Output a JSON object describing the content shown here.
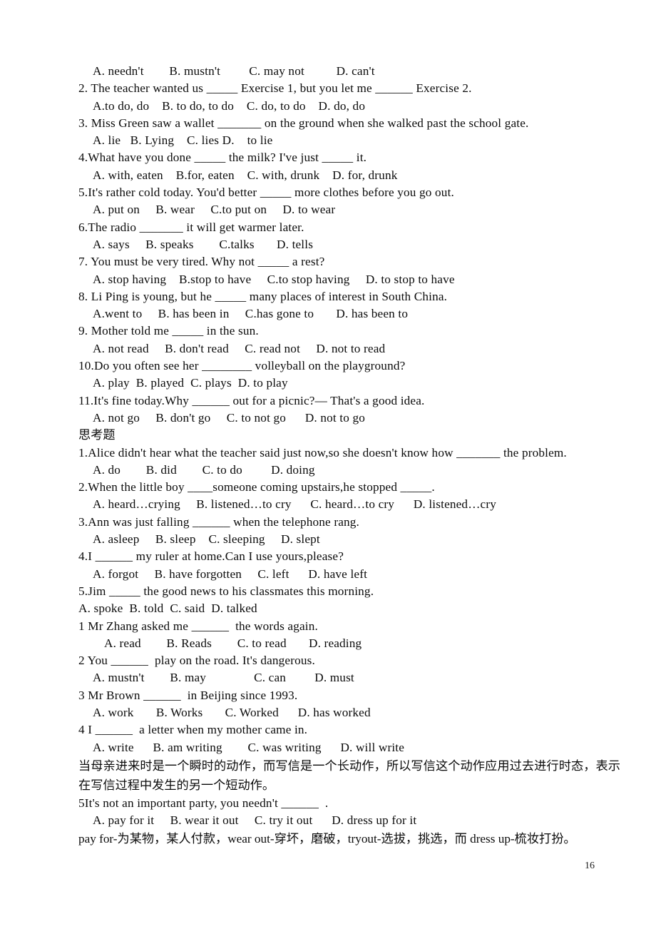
{
  "document": {
    "page_number": "16",
    "sections": [
      {
        "id": "section-main",
        "lines": [
          {
            "type": "option",
            "indent": "normal",
            "text": "A. needn't        B. mustn't         C. may not          D. can't"
          },
          {
            "type": "question",
            "indent": "none",
            "text": "2. The teacher wanted us _____ Exercise 1, but you let me ______ Exercise 2."
          },
          {
            "type": "option",
            "indent": "normal",
            "text": "A.to do, do    B. to do, to do    C. do, to do    D. do, do"
          },
          {
            "type": "question",
            "indent": "none",
            "text": "3. Miss Green saw a wallet _______ on the ground when she walked past the school gate."
          },
          {
            "type": "option",
            "indent": "normal",
            "text": "A. lie   B. Lying    C. lies D.    to lie"
          },
          {
            "type": "question",
            "indent": "none",
            "text": "4.What have you done _____ the milk? I've just _____ it."
          },
          {
            "type": "option",
            "indent": "normal",
            "text": "A. with, eaten    B.for, eaten    C. with, drunk    D. for, drunk"
          },
          {
            "type": "question",
            "indent": "none",
            "text": "5.It's rather cold today. You'd better _____ more clothes before you go out."
          },
          {
            "type": "option",
            "indent": "normal",
            "text": "A. put on     B. wear     C.to put on     D. to wear"
          },
          {
            "type": "question",
            "indent": "none",
            "text": "6.The radio _______ it will get warmer later."
          },
          {
            "type": "option",
            "indent": "normal",
            "text": "A. says     B. speaks        C.talks       D. tells"
          },
          {
            "type": "question",
            "indent": "none",
            "text": "7. You must be very tired. Why not _____ a rest?"
          },
          {
            "type": "option",
            "indent": "normal",
            "text": "A. stop having    B.stop to have     C.to stop having     D. to stop to have"
          },
          {
            "type": "question",
            "indent": "none",
            "text": "8. Li Ping is young, but he _____ many places of interest in South China."
          },
          {
            "type": "option",
            "indent": "normal",
            "text": "A.went to     B. has been in     C.has gone to       D. has been to"
          },
          {
            "type": "question",
            "indent": "none",
            "text": "9. Mother told me _____ in the sun."
          },
          {
            "type": "option",
            "indent": "normal",
            "text": "A. not read     B. don't read     C. read not     D. not to read"
          },
          {
            "type": "question",
            "indent": "none",
            "text": "10.Do you often see her ________ volleyball on the playground?"
          },
          {
            "type": "option",
            "indent": "normal",
            "text": "A. play  B. played  C. plays  D. to play"
          },
          {
            "type": "question",
            "indent": "none",
            "text": "11.It's fine today.Why ______ out for a picnic?— That's a good idea."
          },
          {
            "type": "option",
            "indent": "normal",
            "text": "A. not go     B. don't go     C. to not go      D. not to go"
          }
        ]
      },
      {
        "id": "section-thinking",
        "heading": "思考题",
        "lines": [
          {
            "type": "question",
            "indent": "none",
            "text": "1.Alice didn't hear what the teacher said just now,so she doesn't know how _______ the problem."
          },
          {
            "type": "option",
            "indent": "normal",
            "text": "A. do        B. did        C. to do         D. doing"
          },
          {
            "type": "question",
            "indent": "none",
            "text": "2.When the little boy ____someone coming upstairs,he stopped _____."
          },
          {
            "type": "option",
            "indent": "normal",
            "text": "A. heard…crying     B. listened…to cry      C. heard…to cry      D. listened…cry"
          },
          {
            "type": "question",
            "indent": "none",
            "text": "3.Ann was just falling ______ when the telephone rang."
          },
          {
            "type": "option",
            "indent": "normal",
            "text": "A. asleep     B. sleep    C. sleeping     D. slept"
          },
          {
            "type": "question",
            "indent": "none",
            "text": "4.I ______ my ruler at home.Can I use yours,please?"
          },
          {
            "type": "option",
            "indent": "normal",
            "text": "A. forgot     B. have forgotten     C. left      D. have left"
          },
          {
            "type": "question",
            "indent": "none",
            "text": "5.Jim _____ the good news to his classmates this morning."
          },
          {
            "type": "option",
            "indent": "flush",
            "text": "A. spoke  B. told  C. said  D. talked"
          },
          {
            "type": "question",
            "indent": "none",
            "text": "1 Mr Zhang asked me ______  the words again."
          },
          {
            "type": "option",
            "indent": "deep",
            "text": "A. read        B. Reads        C. to read       D. reading"
          },
          {
            "type": "question",
            "indent": "none",
            "text": "2 You ______  play on the road. It's dangerous."
          },
          {
            "type": "option",
            "indent": "normal",
            "text": "A. mustn't        B. may               C. can         D. must"
          },
          {
            "type": "question",
            "indent": "none",
            "text": "3 Mr Brown ______  in Beijing since 1993."
          },
          {
            "type": "option",
            "indent": "normal",
            "text": "A. work       B. Works       C. Worked      D. has worked"
          },
          {
            "type": "question",
            "indent": "none",
            "text": "4 I ______  a letter when my mother came in."
          },
          {
            "type": "option",
            "indent": "normal",
            "text": "A. write      B. am writing        C. was writing      D. will write"
          },
          {
            "type": "note",
            "indent": "none",
            "text": "当母亲进来时是一个瞬时的动作，而写信是一个长动作，所以写信这个动作应用过去进行时态，表示在写信过程中发生的另一个短动作。"
          },
          {
            "type": "question",
            "indent": "none",
            "text": "5It's not an important party, you needn't ______  ."
          },
          {
            "type": "option",
            "indent": "normal",
            "text": "A. pay for it     B. wear it out     C. try it out      D. dress up for it"
          },
          {
            "type": "note",
            "indent": "none",
            "text": "pay for-为某物，某人付款，wear out-穿坏，磨破，tryout-选拔，挑选，而 dress up-梳妆打扮。"
          }
        ]
      }
    ]
  }
}
